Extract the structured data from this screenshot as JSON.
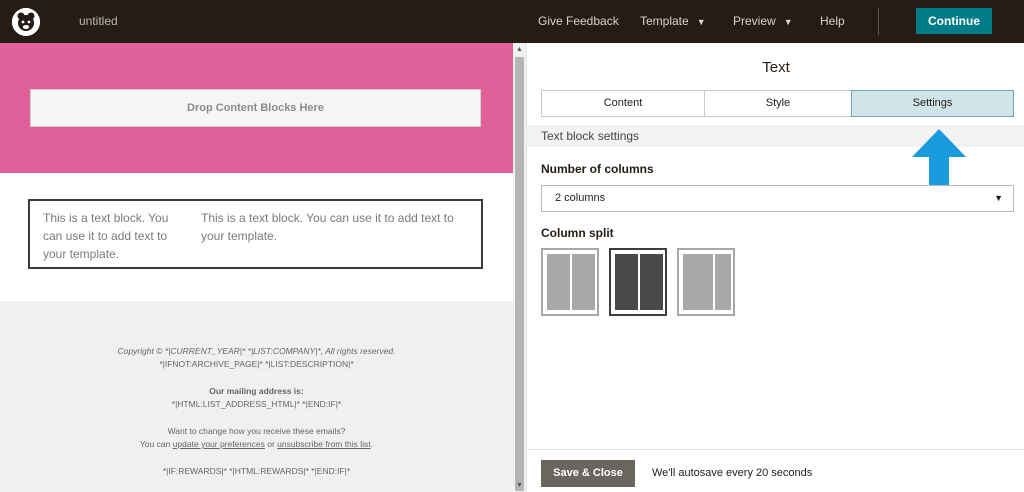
{
  "header": {
    "doc_title": "untitled",
    "nav": {
      "feedback": "Give Feedback",
      "template": "Template",
      "preview": "Preview",
      "help": "Help"
    },
    "continue_label": "Continue"
  },
  "canvas": {
    "drop_label": "Drop Content Blocks Here",
    "text_block": {
      "col1": "This is a text block. You can use it to add text to your template.",
      "col2": "This is a text block. You can use it to add text to your template."
    },
    "footer": {
      "copyright": "Copyright © *|CURRENT_YEAR|* *|LIST:COMPANY|*, All rights reserved.",
      "archive": "*|IFNOT:ARCHIVE_PAGE|* *|LIST:DESCRIPTION|*",
      "mailing_heading": "Our mailing address is:",
      "mailing_value": "*|HTML:LIST_ADDRESS_HTML|* *|END:IF|*",
      "change_line": "Want to change how you receive these emails?",
      "you_can": "You can ",
      "update_link": "update your preferences",
      "or_text": " or ",
      "unsubscribe_link": "unsubscribe from this list",
      "period": ".",
      "rewards": "*|IF:REWARDS|* *|HTML:REWARDS|* *|END:IF|*"
    }
  },
  "panel": {
    "title": "Text",
    "tabs": [
      "Content",
      "Style",
      "Settings"
    ],
    "active_tab": "Settings",
    "section_label": "Text block settings",
    "columns_label": "Number of columns",
    "columns_value": "2 columns",
    "split_label": "Column split",
    "split_options": [
      "50/50",
      "equal",
      "33/66"
    ],
    "selected_split": 1,
    "save_label": "Save & Close",
    "autosave_text": "We'll autosave every 20 seconds"
  },
  "colors": {
    "topbar": "#241c15",
    "accent": "#007c89",
    "header_band": "#e0619a",
    "arrow": "#1a9be0",
    "active_tab": "#cfe5ea"
  }
}
